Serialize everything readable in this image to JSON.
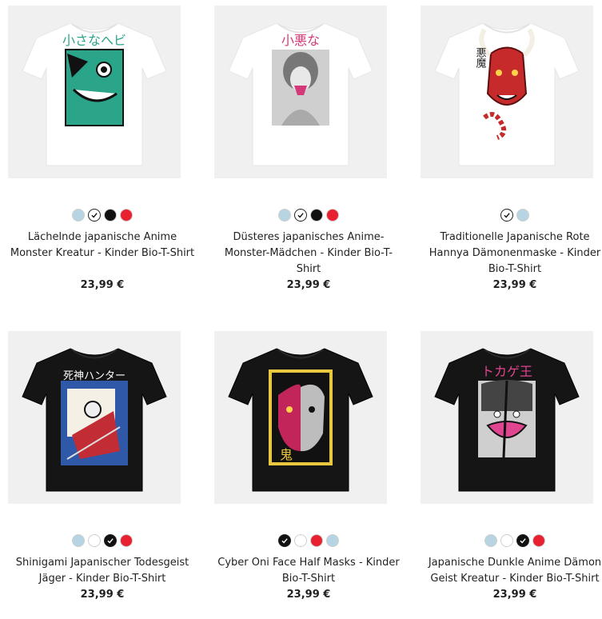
{
  "products": [
    {
      "title": "Lächelnde japanische Anime Monster Kreatur - Kinder Bio-T-Shirt",
      "price": "23,99 €",
      "shirt": "white",
      "design": "monster",
      "design_text": "小さなへビ",
      "swatches": [
        {
          "color": "#b6d4e2",
          "selected": false
        },
        {
          "color": "#ffffff",
          "selected": true
        },
        {
          "color": "#111111",
          "selected": false
        },
        {
          "color": "#e8202f",
          "selected": false
        }
      ]
    },
    {
      "title": "Düsteres japanisches Anime-Monster-Mädchen - Kinder Bio-T-Shirt",
      "price": "23,99 €",
      "shirt": "white",
      "design": "girl",
      "design_text": "小悪な",
      "swatches": [
        {
          "color": "#b6d4e2",
          "selected": false
        },
        {
          "color": "#ffffff",
          "selected": true
        },
        {
          "color": "#111111",
          "selected": false
        },
        {
          "color": "#e8202f",
          "selected": false
        }
      ]
    },
    {
      "title": "Traditionelle Japanische Rote Hannya Dämonenmaske - Kinder Bio-T-Shirt",
      "price": "23,99 €",
      "shirt": "white",
      "design": "hannya",
      "design_text": "悪魔",
      "swatches": [
        {
          "color": "#ffffff",
          "selected": true
        },
        {
          "color": "#b6d4e2",
          "selected": false
        }
      ]
    },
    {
      "title": "Shinigami Japanischer Todesgeist Jäger - Kinder Bio-T-Shirt",
      "price": "23,99 €",
      "shirt": "black",
      "design": "shinigami",
      "design_text": "死神ハンター",
      "swatches": [
        {
          "color": "#b6d4e2",
          "selected": false
        },
        {
          "color": "#ffffff",
          "selected": false
        },
        {
          "color": "#111111",
          "selected": true
        },
        {
          "color": "#e8202f",
          "selected": false
        }
      ]
    },
    {
      "title": "Cyber Oni Face Half Masks - Kinder Bio-T-Shirt",
      "price": "23,99 €",
      "shirt": "black",
      "design": "oni",
      "design_text": "鬼",
      "swatches": [
        {
          "color": "#111111",
          "selected": true
        },
        {
          "color": "#ffffff",
          "selected": false
        },
        {
          "color": "#e8202f",
          "selected": false
        },
        {
          "color": "#b6d4e2",
          "selected": false
        }
      ]
    },
    {
      "title": "Japanische Dunkle Anime Dämon Geist Kreatur - Kinder Bio-T-Shirt",
      "price": "23,99 €",
      "shirt": "black",
      "design": "demon",
      "design_text": "トカゲ王",
      "swatches": [
        {
          "color": "#b6d4e2",
          "selected": false
        },
        {
          "color": "#ffffff",
          "selected": false
        },
        {
          "color": "#111111",
          "selected": true
        },
        {
          "color": "#e8202f",
          "selected": false
        }
      ]
    }
  ]
}
